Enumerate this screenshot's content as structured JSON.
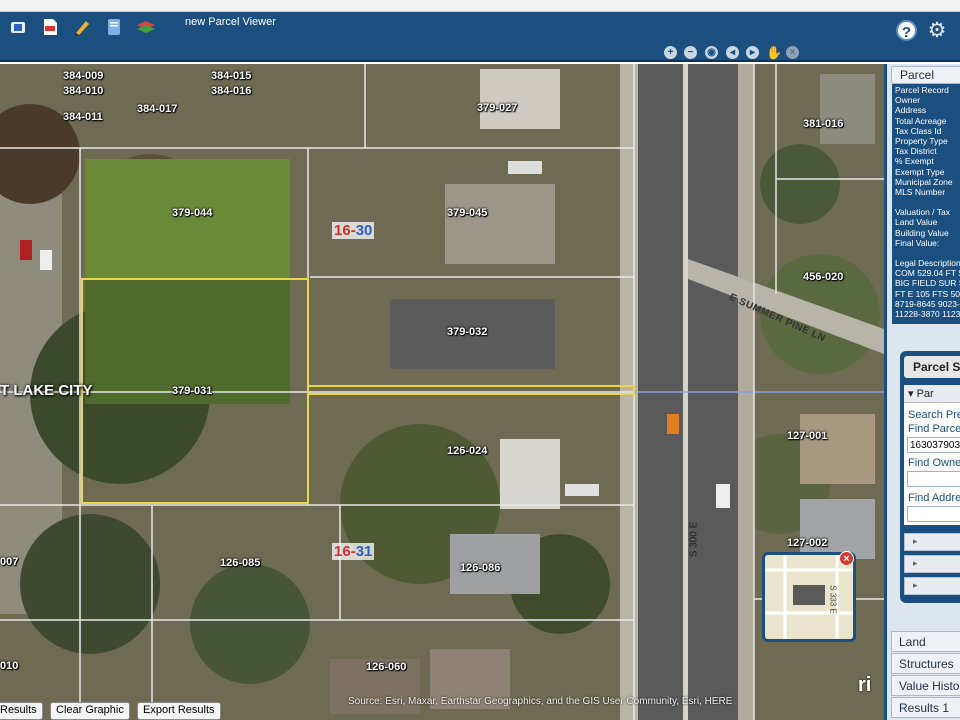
{
  "header": {
    "title": "new Parcel Viewer",
    "toolbar_icons": [
      "toolbox-icon",
      "pdf-icon",
      "pencil-icon",
      "document-icon",
      "layers-icon"
    ],
    "nav_icons": [
      "zoom-in-icon",
      "zoom-out-icon",
      "full-extent-icon",
      "previous-extent-icon",
      "next-extent-icon",
      "pan-icon",
      "close-circle-icon"
    ],
    "help_label": "?",
    "colors": {
      "header_bg": "#1b4f7f",
      "parcel_outline": "#e6d84a",
      "grid_red": "#d23030",
      "grid_blue": "#2b5fc4"
    }
  },
  "map": {
    "parcel_labels": [
      "384-009",
      "384-010",
      "384-011",
      "384-015",
      "384-016",
      "384-017",
      "379-027",
      "381-016",
      "379-044",
      "379-045",
      "456-020",
      "379-032",
      "379-031",
      "126-024",
      "127-001",
      "126-085",
      "126-086",
      "127-002",
      "126-060",
      "007",
      "010"
    ],
    "grid_labels": [
      {
        "a": "16",
        "sep": "-",
        "b": "30"
      },
      {
        "a": "16",
        "sep": "-",
        "b": "31"
      }
    ],
    "city_label": "T LAKE CITY",
    "street_summer_pine": "E SUMMER PINE LN",
    "street_300e": "S 300 E",
    "attribution": "Source: Esri, Maxar, Earthstar Geographics, and the GIS User Community, Esri, HERE",
    "esri_logo": "ri",
    "overview_street": "S 333 E"
  },
  "bottom_buttons": {
    "results": "Results",
    "clear_graphic": "Clear Graphic",
    "export_results": "Export Results"
  },
  "sidebar": {
    "parcel_header": "Parcel",
    "fields": [
      "Parcel Record",
      "Owner",
      "Address",
      "Total Acreage",
      "Tax Class Id",
      "Property Type",
      "Tax District",
      "% Exempt",
      "Exempt Type",
      "Municipal Zone",
      "MLS Number",
      "",
      "Valuation / Tax",
      "Land Value",
      "Building Value",
      "Final Value:",
      "",
      "Legal Description",
      "COM 529.04 FT S",
      "BIG FIELD SUR S",
      "FT E 105 FTS 50",
      "8719-8645 9023-",
      "11228-3870 1123"
    ],
    "search_title": "Parcel S",
    "panel_bar": "Par",
    "search_prefix": "Search Pre",
    "find_parcel_label": "Find Parcel",
    "find_parcel_value": "163037903",
    "find_owner_label": "Find Owne",
    "find_owner_value": "",
    "find_address_label": "Find Addre",
    "find_address_value": "",
    "tabs": [
      "Land",
      "Structures",
      "Value Histo",
      "Results 1"
    ]
  }
}
